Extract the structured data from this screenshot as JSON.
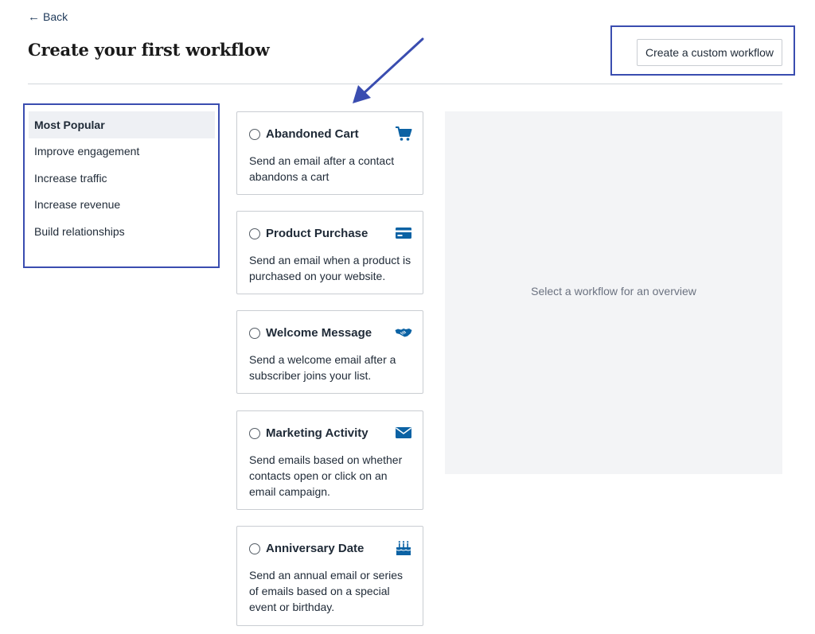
{
  "nav": {
    "back_label": "Back"
  },
  "header": {
    "title": "Create your first workflow",
    "custom_button_label": "Create a custom workflow"
  },
  "sidebar": {
    "items": [
      {
        "label": "Most Popular",
        "active": true
      },
      {
        "label": "Improve engagement",
        "active": false
      },
      {
        "label": "Increase traffic",
        "active": false
      },
      {
        "label": "Increase revenue",
        "active": false
      },
      {
        "label": "Build relationships",
        "active": false
      }
    ]
  },
  "workflows": [
    {
      "title": "Abandoned Cart",
      "description": "Send an email after a contact abandons a cart",
      "icon": "shopping-cart-icon"
    },
    {
      "title": "Product Purchase",
      "description": "Send an email when a product is purchased on your website.",
      "icon": "credit-card-icon"
    },
    {
      "title": "Welcome Message",
      "description": "Send a welcome email after a subscriber joins your list.",
      "icon": "handshake-icon"
    },
    {
      "title": "Marketing Activity",
      "description": "Send emails based on whether contacts open or click on an email campaign.",
      "icon": "envelope-icon"
    },
    {
      "title": "Anniversary Date",
      "description": "Send an annual email or series of emails based on a special event or birthday.",
      "icon": "birthday-cake-icon"
    }
  ],
  "overview": {
    "placeholder": "Select a workflow for an overview"
  },
  "colors": {
    "accent_icon": "#0b62a4",
    "highlight_box": "#3a4db0",
    "overview_bg": "#f3f4f6"
  }
}
